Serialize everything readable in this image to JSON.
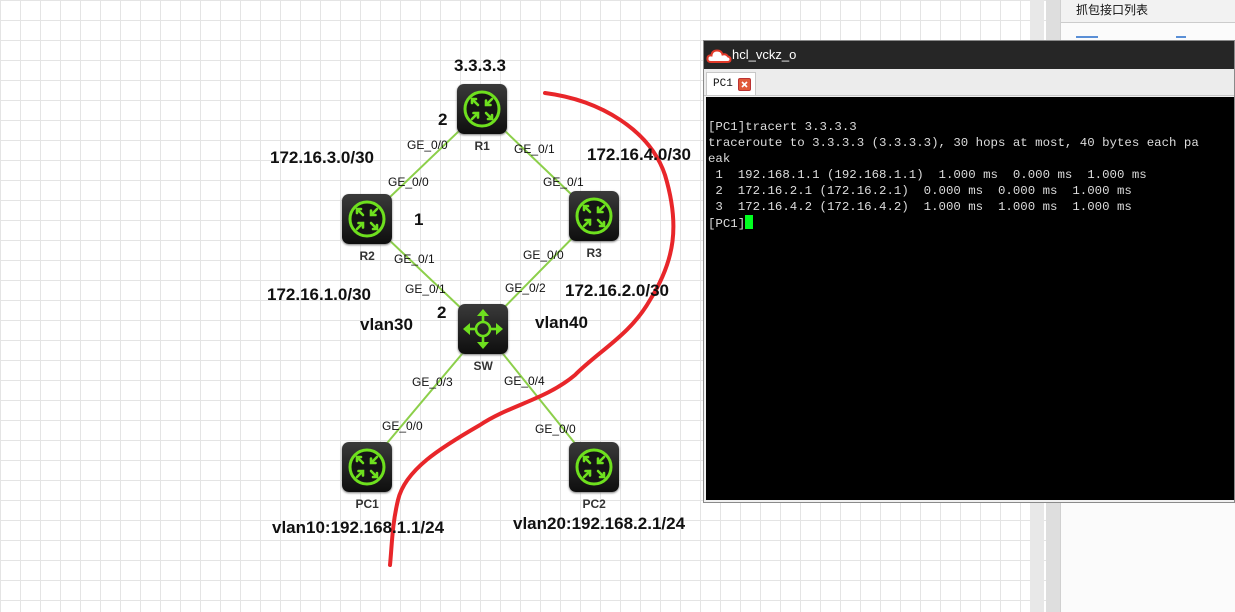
{
  "topology": {
    "nodes": [
      {
        "id": "R1",
        "name": "R1",
        "type": "router"
      },
      {
        "id": "R2",
        "name": "R2",
        "type": "router"
      },
      {
        "id": "R3",
        "name": "R3",
        "type": "router"
      },
      {
        "id": "SW",
        "name": "SW",
        "type": "switch"
      },
      {
        "id": "PC1",
        "name": "PC1",
        "type": "router"
      },
      {
        "id": "PC2",
        "name": "PC2",
        "type": "router"
      }
    ],
    "links": [
      {
        "from": "R1",
        "to": "R2",
        "from_port": "GE_0/0",
        "to_port": "GE_0/0"
      },
      {
        "from": "R1",
        "to": "R3",
        "from_port": "GE_0/1",
        "to_port": "GE_0/1"
      },
      {
        "from": "R2",
        "to": "SW",
        "from_port": "GE_0/1",
        "to_port": "GE_0/1"
      },
      {
        "from": "R3",
        "to": "SW",
        "from_port": "GE_0/0",
        "to_port": "GE_0/2"
      },
      {
        "from": "SW",
        "to": "PC1",
        "from_port": "GE_0/3",
        "to_port": "GE_0/0"
      },
      {
        "from": "SW",
        "to": "PC2",
        "from_port": "GE_0/4",
        "to_port": "GE_0/0"
      }
    ],
    "annotations": {
      "r1_loopback": "3.3.3.3",
      "r1_area": "2",
      "r2_area": "1",
      "sw_area": "2",
      "net_r1_r2": "172.16.3.0/30",
      "net_r1_r3": "172.16.4.0/30",
      "net_r2_sw": "172.16.1.0/30",
      "net_r3_sw": "172.16.2.0/30",
      "vlan_left": "vlan30",
      "vlan_right": "vlan40",
      "pc1_vlan": "vlan10:192.168.1.1/24",
      "pc2_vlan": "vlan20:192.168.2.1/24"
    },
    "colors": {
      "link": "#8ccf4a",
      "icon_green": "#6ee01e",
      "scribble": "#e8262a"
    }
  },
  "side_panel": {
    "title": "抓包接口列表"
  },
  "terminal": {
    "window_title": "hcl_vckz_o",
    "tab_label": "PC1",
    "lines": [
      "[PC1]tracert 3.3.3.3",
      "traceroute to 3.3.3.3 (3.3.3.3), 30 hops at most, 40 bytes each pa",
      "eak",
      " 1  192.168.1.1 (192.168.1.1)  1.000 ms  0.000 ms  1.000 ms",
      " 2  172.16.2.1 (172.16.2.1)  0.000 ms  0.000 ms  1.000 ms",
      " 3  172.16.4.2 (172.16.4.2)  1.000 ms  1.000 ms  1.000 ms"
    ],
    "prompt": "[PC1]"
  }
}
